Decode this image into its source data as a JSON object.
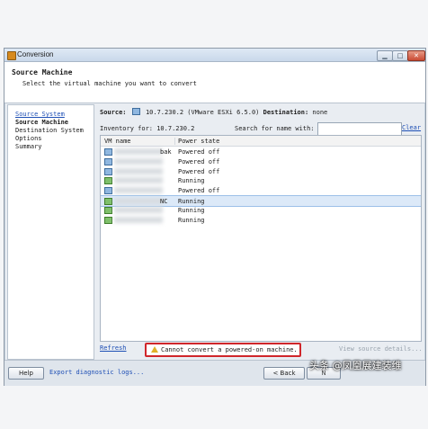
{
  "window": {
    "title": "Conversion"
  },
  "header": {
    "title": "Source Machine",
    "subtitle": "Select the virtual machine you want to convert"
  },
  "nav": {
    "items": [
      "Source System",
      "Source Machine",
      "Destination System",
      "Options",
      "Summary"
    ]
  },
  "source": {
    "label": "Source:",
    "value": "10.7.230.2 (VMware ESXi 6.5.0)",
    "dest_label": "Destination:",
    "dest_value": "none",
    "inventory": "Inventory for: 10.7.230.2",
    "search_label": "Search for name with:",
    "search_value": "",
    "clear": "Clear"
  },
  "table": {
    "columns": [
      "VM name",
      "Power state"
    ],
    "rows": [
      {
        "name": "bak",
        "state": "Powered off",
        "icon": "vm-off-icon",
        "selected": false
      },
      {
        "name": "",
        "state": "Powered off",
        "icon": "vm-off-icon",
        "selected": false
      },
      {
        "name": "",
        "state": "Powered off",
        "icon": "vm-off-icon",
        "selected": false
      },
      {
        "name": "",
        "state": "Running",
        "icon": "vm-on-icon",
        "selected": false
      },
      {
        "name": "",
        "state": "Powered off",
        "icon": "vm-off-icon",
        "selected": false
      },
      {
        "name": "NC",
        "state": "Running",
        "icon": "vm-on-icon",
        "selected": true
      },
      {
        "name": "",
        "state": "Running",
        "icon": "vm-on-icon",
        "selected": false
      },
      {
        "name": "",
        "state": "Running",
        "icon": "vm-on-icon",
        "selected": false
      }
    ]
  },
  "actions": {
    "refresh": "Refresh",
    "warning": "Cannot convert a powered-on machine.",
    "view_details": "View source details..."
  },
  "footer": {
    "help": "Help",
    "export": "Export diagnostic logs...",
    "back": "< Back",
    "next": "N"
  },
  "watermark": "头条 @凤凰展建装维"
}
